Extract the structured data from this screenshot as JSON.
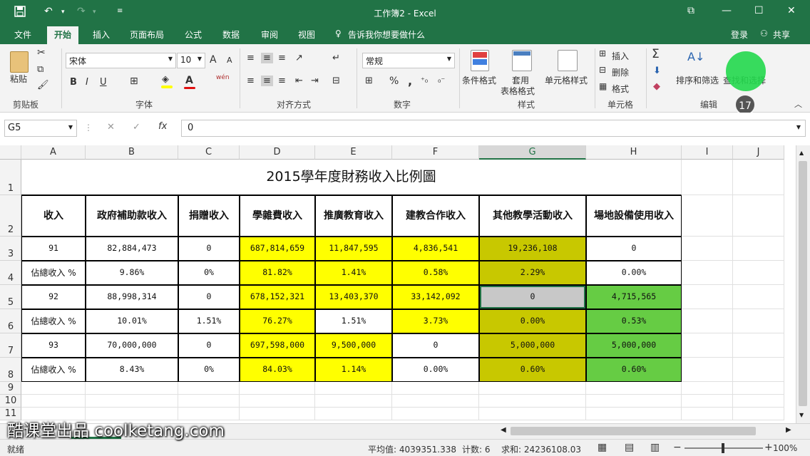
{
  "window": {
    "title": "工作簿2 - Excel",
    "login": "登录",
    "share": "共享"
  },
  "tabs": [
    {
      "label": "文件"
    },
    {
      "label": "开始"
    },
    {
      "label": "插入"
    },
    {
      "label": "页面布局"
    },
    {
      "label": "公式"
    },
    {
      "label": "数据"
    },
    {
      "label": "审阅"
    },
    {
      "label": "视图"
    }
  ],
  "tell_me": "告诉我你想要做什么",
  "ribbon": {
    "clipboard": {
      "group": "剪贴板",
      "paste": "粘贴"
    },
    "font": {
      "group": "字体",
      "family": "宋体",
      "size": "10",
      "bold": "B",
      "italic": "I",
      "underline": "U",
      "grow": "A",
      "shrink": "A",
      "wen": "wén"
    },
    "alignment": {
      "group": "对齐方式"
    },
    "number": {
      "group": "数字",
      "format": "常规",
      "percent": "%",
      "comma": ","
    },
    "styles": {
      "group": "样式",
      "conditional": "条件格式",
      "table_fmt_1": "套用",
      "table_fmt_2": "表格格式",
      "cell_styles": "单元格样式"
    },
    "cells": {
      "group": "单元格",
      "insert": "插入",
      "delete": "删除",
      "format": "格式"
    },
    "editing": {
      "group": "编辑",
      "sort": "排序和筛选",
      "find": "查找和选择",
      "sigma": "Σ"
    },
    "step_badge": "17"
  },
  "formula_bar": {
    "name_box": "G5",
    "fx": "fx",
    "value": "0"
  },
  "columns": [
    "A",
    "B",
    "C",
    "D",
    "E",
    "F",
    "G",
    "H",
    "I",
    "J"
  ],
  "selected_column": "G",
  "rows": [
    "1",
    "2",
    "3",
    "4",
    "5",
    "6",
    "7",
    "8",
    "9",
    "10",
    "11"
  ],
  "sheet": {
    "title": "2015學年度財務收入比例圖",
    "headers": [
      "收入",
      "政府補助款收入",
      "捐贈收入",
      "學雜費收入",
      "推廣教育收入",
      "建教合作收入",
      "其他教學活動收入",
      "場地設備使用收入"
    ],
    "table": [
      [
        "91",
        "82,884,473",
        "0",
        "687,814,659",
        "11,847,595",
        "4,836,541",
        "19,236,108",
        "0"
      ],
      [
        "佔總收入 %",
        "9.86%",
        "0%",
        "81.82%",
        "1.41%",
        "0.58%",
        "2.29%",
        "0.00%"
      ],
      [
        "92",
        "88,998,314",
        "0",
        "678,152,321",
        "13,403,370",
        "33,142,092",
        "0",
        "4,715,565"
      ],
      [
        "佔總收入 %",
        "10.01%",
        "1.51%",
        "76.27%",
        "1.51%",
        "3.73%",
        "0.00%",
        "0.53%"
      ],
      [
        "93",
        "70,000,000",
        "0",
        "697,598,000",
        "9,500,000",
        "0",
        "5,000,000",
        "5,000,000"
      ],
      [
        "佔總收入 %",
        "8.43%",
        "0%",
        "84.03%",
        "1.14%",
        "0.00%",
        "0.60%",
        "0.60%"
      ]
    ],
    "fills": [
      [
        "#ffffff",
        "#ffffff",
        "#ffffff",
        "#ffff00",
        "#ffff00",
        "#ffff00",
        "#c8c800",
        "#ffffff"
      ],
      [
        "#ffffff",
        "#ffffff",
        "#ffffff",
        "#ffff00",
        "#ffff00",
        "#ffff00",
        "#c8c800",
        "#ffffff"
      ],
      [
        "#ffffff",
        "#ffffff",
        "#ffffff",
        "#ffff00",
        "#ffff00",
        "#ffff00",
        "#c8c8c8",
        "#66cc44"
      ],
      [
        "#ffffff",
        "#ffffff",
        "#ffffff",
        "#ffff00",
        "#ffffff",
        "#ffff00",
        "#c8c800",
        "#66cc44"
      ],
      [
        "#ffffff",
        "#ffffff",
        "#ffffff",
        "#ffff00",
        "#ffff00",
        "#ffffff",
        "#c8c800",
        "#66cc44"
      ],
      [
        "#ffffff",
        "#ffffff",
        "#ffffff",
        "#ffff00",
        "#ffff00",
        "#ffffff",
        "#c8c800",
        "#66cc44"
      ]
    ]
  },
  "status": {
    "ready": "就绪",
    "average": "平均值: 4039351.338",
    "count": "计数: 6",
    "sum": "求和: 24236108.03",
    "zoom": "100%"
  },
  "watermark": "酷课堂出品 coolketang.com",
  "colors": {
    "accent": "#217346",
    "yellow": "#ffff00",
    "olive": "#c8c800",
    "green": "#66cc44",
    "highlight": "#22d84c"
  }
}
